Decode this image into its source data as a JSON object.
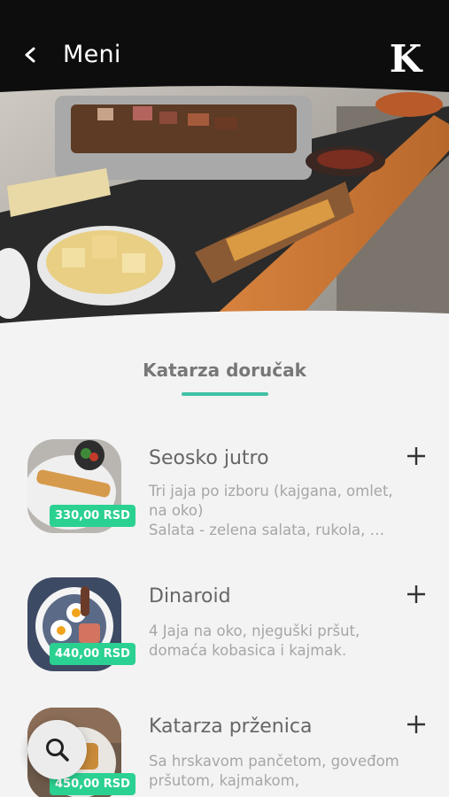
{
  "header": {
    "title": "Meni",
    "back_icon": "chevron-left-icon",
    "logo_letter": "K"
  },
  "section": {
    "title": "Katarza doručak",
    "accent_color": "#40c0a4"
  },
  "price_badge_color": "#2bd191",
  "items": [
    {
      "title": "Seosko jutro",
      "description": "Tri jaja po izboru (kajgana, omlet, na oko)\nSalata - zelena salata, rukola, …",
      "price": "330,00 RSD"
    },
    {
      "title": "Dinaroid",
      "description": "4 Jaja na oko, njeguški pršut, domaća kobasica i kajmak.",
      "price": "440,00 RSD"
    },
    {
      "title": "Katarza prženica",
      "description": "Sa hrskavom pančetom, goveđom pršutom, kajmakom,",
      "price": "450,00 RSD"
    }
  ],
  "fab": {
    "icon": "search-icon"
  }
}
